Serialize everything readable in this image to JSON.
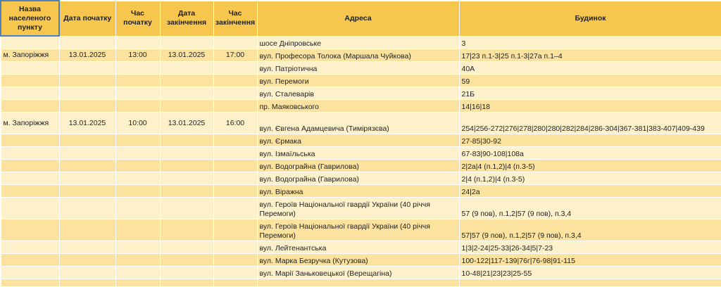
{
  "headers": [
    "Назва населеного пункту",
    "Дата початку",
    "Час початку",
    "Дата закінчення",
    "Час закінчення",
    "Адреса",
    "Будинок"
  ],
  "rows": [
    {
      "city": "",
      "date_start": "",
      "time_start": "",
      "date_end": "",
      "time_end": "",
      "address": "шосе Дніпровське",
      "building": "3"
    },
    {
      "city": "м. Запоріжжя",
      "date_start": "13.01.2025",
      "time_start": "13:00",
      "date_end": "13.01.2025",
      "time_end": "17:00",
      "address": "вул. Професора Толока (Маршала Чуйкова)",
      "building": "17|23 п.1-3|25 п.1-3|27а п.1–4"
    },
    {
      "city": "",
      "date_start": "",
      "time_start": "",
      "date_end": "",
      "time_end": "",
      "address": "вул. Патріотична",
      "building": "40А"
    },
    {
      "city": "",
      "date_start": "",
      "time_start": "",
      "date_end": "",
      "time_end": "",
      "address": "вул. Перемоги",
      "building": "59"
    },
    {
      "city": "",
      "date_start": "",
      "time_start": "",
      "date_end": "",
      "time_end": "",
      "address": "вул. Сталеварів",
      "building": "21Б"
    },
    {
      "city": "",
      "date_start": "",
      "time_start": "",
      "date_end": "",
      "time_end": "",
      "address": "пр. Маяковського",
      "building": "14|16|18"
    },
    {
      "city": "м. Запоріжжя",
      "date_start": "13.01.2025",
      "time_start": "10:00",
      "date_end": "13.01.2025",
      "time_end": "16:00",
      "address": "вул. Євгена Адамцевича (Тимірязєва)",
      "building": "254|256-272|276|278|280|280|282|284|286-304|367-381|383-407|409-439",
      "tall": true
    },
    {
      "city": "",
      "date_start": "",
      "time_start": "",
      "date_end": "",
      "time_end": "",
      "address": "вул. Єрмака",
      "building": "27-85|30-92"
    },
    {
      "city": "",
      "date_start": "",
      "time_start": "",
      "date_end": "",
      "time_end": "",
      "address": "вул. Ізмаїльська",
      "building": "67-83|90-108|108а"
    },
    {
      "city": "",
      "date_start": "",
      "time_start": "",
      "date_end": "",
      "time_end": "",
      "address": "вул. Водограйна (Гаврилова)",
      "building": "2|2а|4 (п.1,2)|4 (п.3-5)"
    },
    {
      "city": "",
      "date_start": "",
      "time_start": "",
      "date_end": "",
      "time_end": "",
      "address": "вул. Водограйна (Гаврилова)",
      "building": "2|4 (п.1,2)|4 (п.3-5)"
    },
    {
      "city": "",
      "date_start": "",
      "time_start": "",
      "date_end": "",
      "time_end": "",
      "address": "вул. Віражна",
      "building": "24|2а"
    },
    {
      "city": "",
      "date_start": "",
      "time_start": "",
      "date_end": "",
      "time_end": "",
      "address": "вул. Героїв Національної гвардії України (40 річчя Перемоги)",
      "building": "57 (9 пов), п.1,2|57 (9 пов), п.3,4",
      "tall": true
    },
    {
      "city": "",
      "date_start": "",
      "time_start": "",
      "date_end": "",
      "time_end": "",
      "address": "вул. Героїв Національної гвардії України (40 річчя Перемоги)",
      "building": "57|57 (9 пов), п.1,2|57 (9 пов), п.3,4",
      "tall": true
    },
    {
      "city": "",
      "date_start": "",
      "time_start": "",
      "date_end": "",
      "time_end": "",
      "address": "вул. Лейтенантська",
      "building": "1|3|2-24|25-33|26-34|5|7-23"
    },
    {
      "city": "",
      "date_start": "",
      "time_start": "",
      "date_end": "",
      "time_end": "",
      "address": "вул. Марка Безручка (Кутузова)",
      "building": "100-122|117-139|76г|76-98|91-115"
    },
    {
      "city": "",
      "date_start": "",
      "time_start": "",
      "date_end": "",
      "time_end": "",
      "address": "вул. Марії Заньковецької (Верещагіна)",
      "building": "10-48|21|23|23|25-55"
    }
  ]
}
